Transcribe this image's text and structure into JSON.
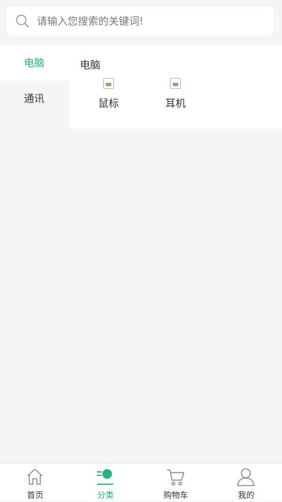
{
  "search": {
    "placeholder": "请输入您搜索的关键词!"
  },
  "categories": {
    "nav": [
      {
        "label": "电脑",
        "active": true
      },
      {
        "label": "通讯",
        "active": false
      }
    ],
    "section_title": "电脑",
    "products": [
      {
        "label": "鼠标"
      },
      {
        "label": "耳机"
      }
    ]
  },
  "tabbar": {
    "items": [
      {
        "label": "首页",
        "icon": "home-icon"
      },
      {
        "label": "分类",
        "icon": "category-icon",
        "active": true
      },
      {
        "label": "购物车",
        "icon": "cart-icon"
      },
      {
        "label": "我的",
        "icon": "user-icon"
      }
    ]
  },
  "colors": {
    "accent": "#1bb87a",
    "background": "#f5f5f7"
  }
}
